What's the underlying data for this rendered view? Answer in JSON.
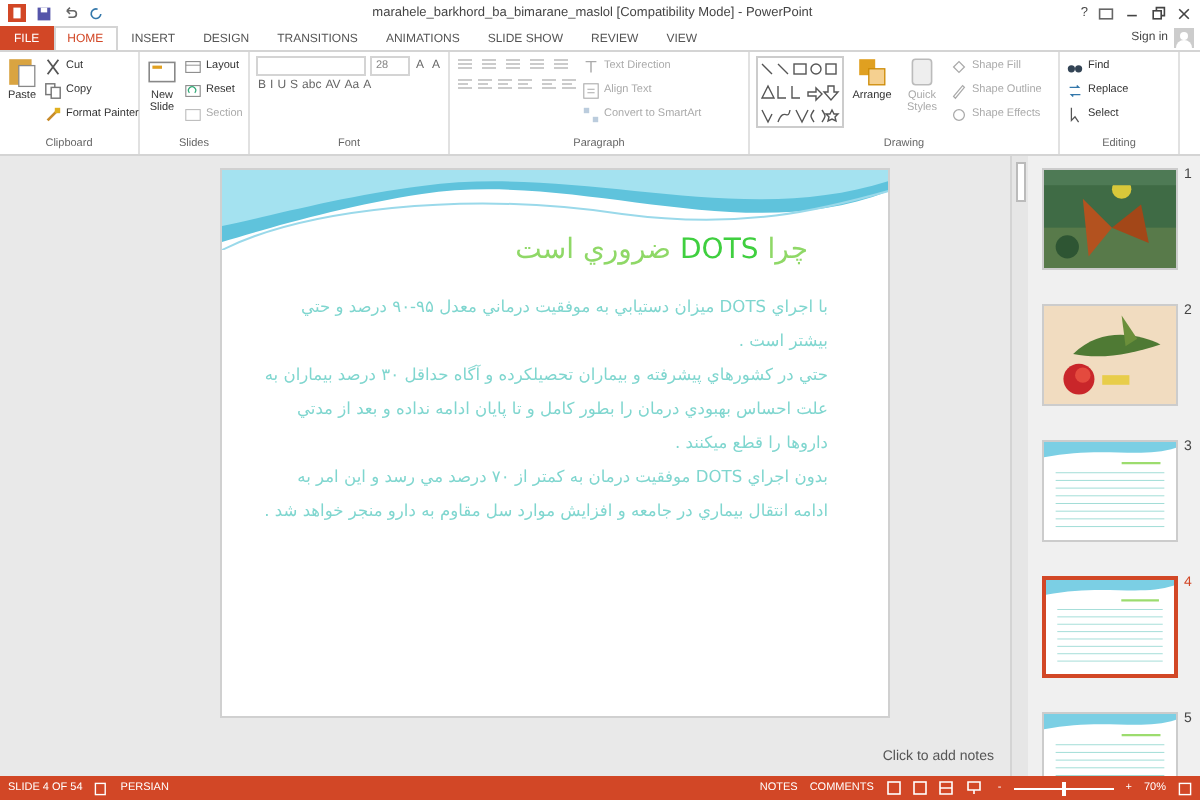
{
  "window": {
    "title": "marahele_barkhord_ba_bimarane_maslol [Compatibility Mode] - PowerPoint",
    "help": "?"
  },
  "tabs": [
    {
      "label": "FILE",
      "kind": "file",
      "selected": false
    },
    {
      "label": "HOME",
      "kind": "tab",
      "selected": true
    },
    {
      "label": "INSERT",
      "kind": "tab",
      "selected": false
    },
    {
      "label": "DESIGN",
      "kind": "tab",
      "selected": false
    },
    {
      "label": "TRANSITIONS",
      "kind": "tab",
      "selected": false
    },
    {
      "label": "ANIMATIONS",
      "kind": "tab",
      "selected": false
    },
    {
      "label": "SLIDE SHOW",
      "kind": "tab",
      "selected": false
    },
    {
      "label": "REVIEW",
      "kind": "tab",
      "selected": false
    },
    {
      "label": "VIEW",
      "kind": "tab",
      "selected": false
    }
  ],
  "account": {
    "label": "Sign in"
  },
  "ribbon": {
    "groups": [
      {
        "label": "Clipboard",
        "kind": "buttons",
        "items": [
          {
            "label": "Paste",
            "kind": "large",
            "disabled": false
          },
          {
            "label": "Cut",
            "kind": "small",
            "disabled": false
          },
          {
            "label": "Copy",
            "kind": "small",
            "disabled": false
          },
          {
            "label": "Format Painter",
            "kind": "small",
            "disabled": false
          }
        ]
      },
      {
        "label": "Slides",
        "kind": "buttons",
        "items": [
          {
            "label": "New Slide",
            "kind": "large",
            "disabled": false
          },
          {
            "label": "Layout",
            "kind": "small",
            "disabled": false
          },
          {
            "label": "Reset",
            "kind": "small",
            "disabled": false
          },
          {
            "label": "Section",
            "kind": "small",
            "disabled": true
          }
        ]
      },
      {
        "label": "Font",
        "kind": "font",
        "font_size": "28",
        "size_buttons": [
          "A",
          "A"
        ],
        "format_buttons": [
          "B",
          "I",
          "U",
          "S",
          "abc",
          "AV",
          "Aa",
          "A"
        ]
      },
      {
        "label": "Paragraph",
        "kind": "paragraph",
        "items": [
          {
            "label": "Text Direction",
            "kind": "small",
            "disabled": true
          },
          {
            "label": "Align Text",
            "kind": "small",
            "disabled": true
          },
          {
            "label": "Convert to SmartArt",
            "kind": "small",
            "disabled": true
          }
        ]
      },
      {
        "label": "Drawing",
        "kind": "drawing",
        "items": [
          {
            "label": "Arrange",
            "kind": "large",
            "disabled": false
          },
          {
            "label": "Quick Styles",
            "kind": "large",
            "disabled": true
          },
          {
            "label": "Shape Fill",
            "kind": "small",
            "disabled": true
          },
          {
            "label": "Shape Outline",
            "kind": "small",
            "disabled": true
          },
          {
            "label": "Shape Effects",
            "kind": "small",
            "disabled": true
          }
        ]
      },
      {
        "label": "Editing",
        "kind": "buttons",
        "items": [
          {
            "label": "Find",
            "kind": "small",
            "disabled": false
          },
          {
            "label": "Replace",
            "kind": "small",
            "disabled": false
          },
          {
            "label": "Select",
            "kind": "small",
            "disabled": false
          }
        ]
      }
    ]
  },
  "slide": {
    "title_before": "چرا",
    "title_highlight": "DOTS",
    "title_after": "ضروري است",
    "paragraphs": [
      "با اجراي DOTS ميزان دستيابي به موفقيت درماني معدل ۹۵-۹۰ درصد و حتي بيشتر است .",
      "حتي در كشورهاي پيشرفته  و بيماران تحصيلكرده و آگاه حداقل ۳۰ درصد بيماران به علت احساس بهبودي درمان را بطور كامل و تا  پايان ادامه نداده و بعد از مدتي داروها را قطع ميكنند .",
      "بدون اجراي  DOTS موفقيت درمان به كمتر از ۷۰ درصد مي رسد و اين امر به ادامه انتقال بيماري در جامعه و افزايش موارد سل  مقاوم  به دارو منجر خواهد شد ."
    ]
  },
  "notes": {
    "placeholder": "Click to add notes"
  },
  "thumbnails": [
    {
      "number": "1",
      "kind": "picture",
      "selected": false
    },
    {
      "number": "2",
      "kind": "picture",
      "selected": false
    },
    {
      "number": "3",
      "kind": "text",
      "selected": false
    },
    {
      "number": "4",
      "kind": "text",
      "selected": true
    },
    {
      "number": "5",
      "kind": "text",
      "selected": false
    }
  ],
  "status_bar": {
    "slide": "SLIDE 4 OF 54",
    "language": "PERSIAN",
    "notes": "NOTES",
    "comments": "COMMENTS",
    "zoom_minus": "-",
    "zoom_plus": "+",
    "zoom": {
      "level": 0.5
    },
    "zoom_reading": "70%"
  }
}
